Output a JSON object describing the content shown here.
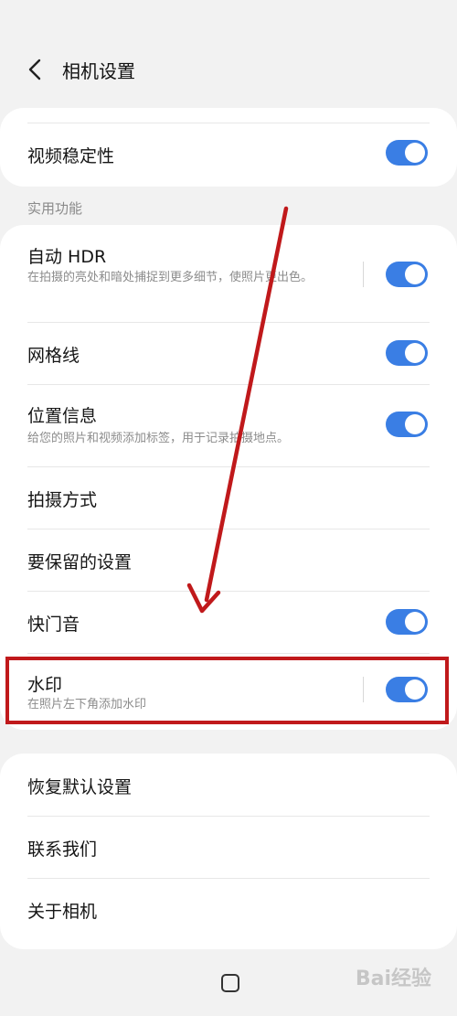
{
  "header": {
    "title": "相机设置",
    "back_icon": "chevron-left-icon"
  },
  "card1": {
    "video_stabilization": {
      "label": "视频稳定性",
      "enabled": true
    }
  },
  "section": {
    "label": "实用功能"
  },
  "settings": {
    "auto_hdr": {
      "label": "自动 HDR",
      "desc": "在拍摄的亮处和暗处捕捉到更多细节，使照片更出色。",
      "enabled": true
    },
    "grid_lines": {
      "label": "网格线",
      "enabled": true
    },
    "location": {
      "label": "位置信息",
      "desc": "给您的照片和视频添加标签，用于记录拍摄地点。",
      "enabled": true
    },
    "shooting_methods": {
      "label": "拍摄方式"
    },
    "settings_to_keep": {
      "label": "要保留的设置"
    },
    "shutter_sound": {
      "label": "快门音",
      "enabled": true
    },
    "watermark": {
      "label": "水印",
      "desc": "在照片左下角添加水印",
      "enabled": true
    }
  },
  "card3": {
    "reset": {
      "label": "恢复默认设置"
    },
    "contact": {
      "label": "联系我们"
    },
    "about": {
      "label": "关于相机"
    }
  },
  "colors": {
    "accent": "#3a7ee4",
    "annotation": "#c0191b"
  },
  "overlay": {
    "watermark_text": "Bai经验"
  }
}
